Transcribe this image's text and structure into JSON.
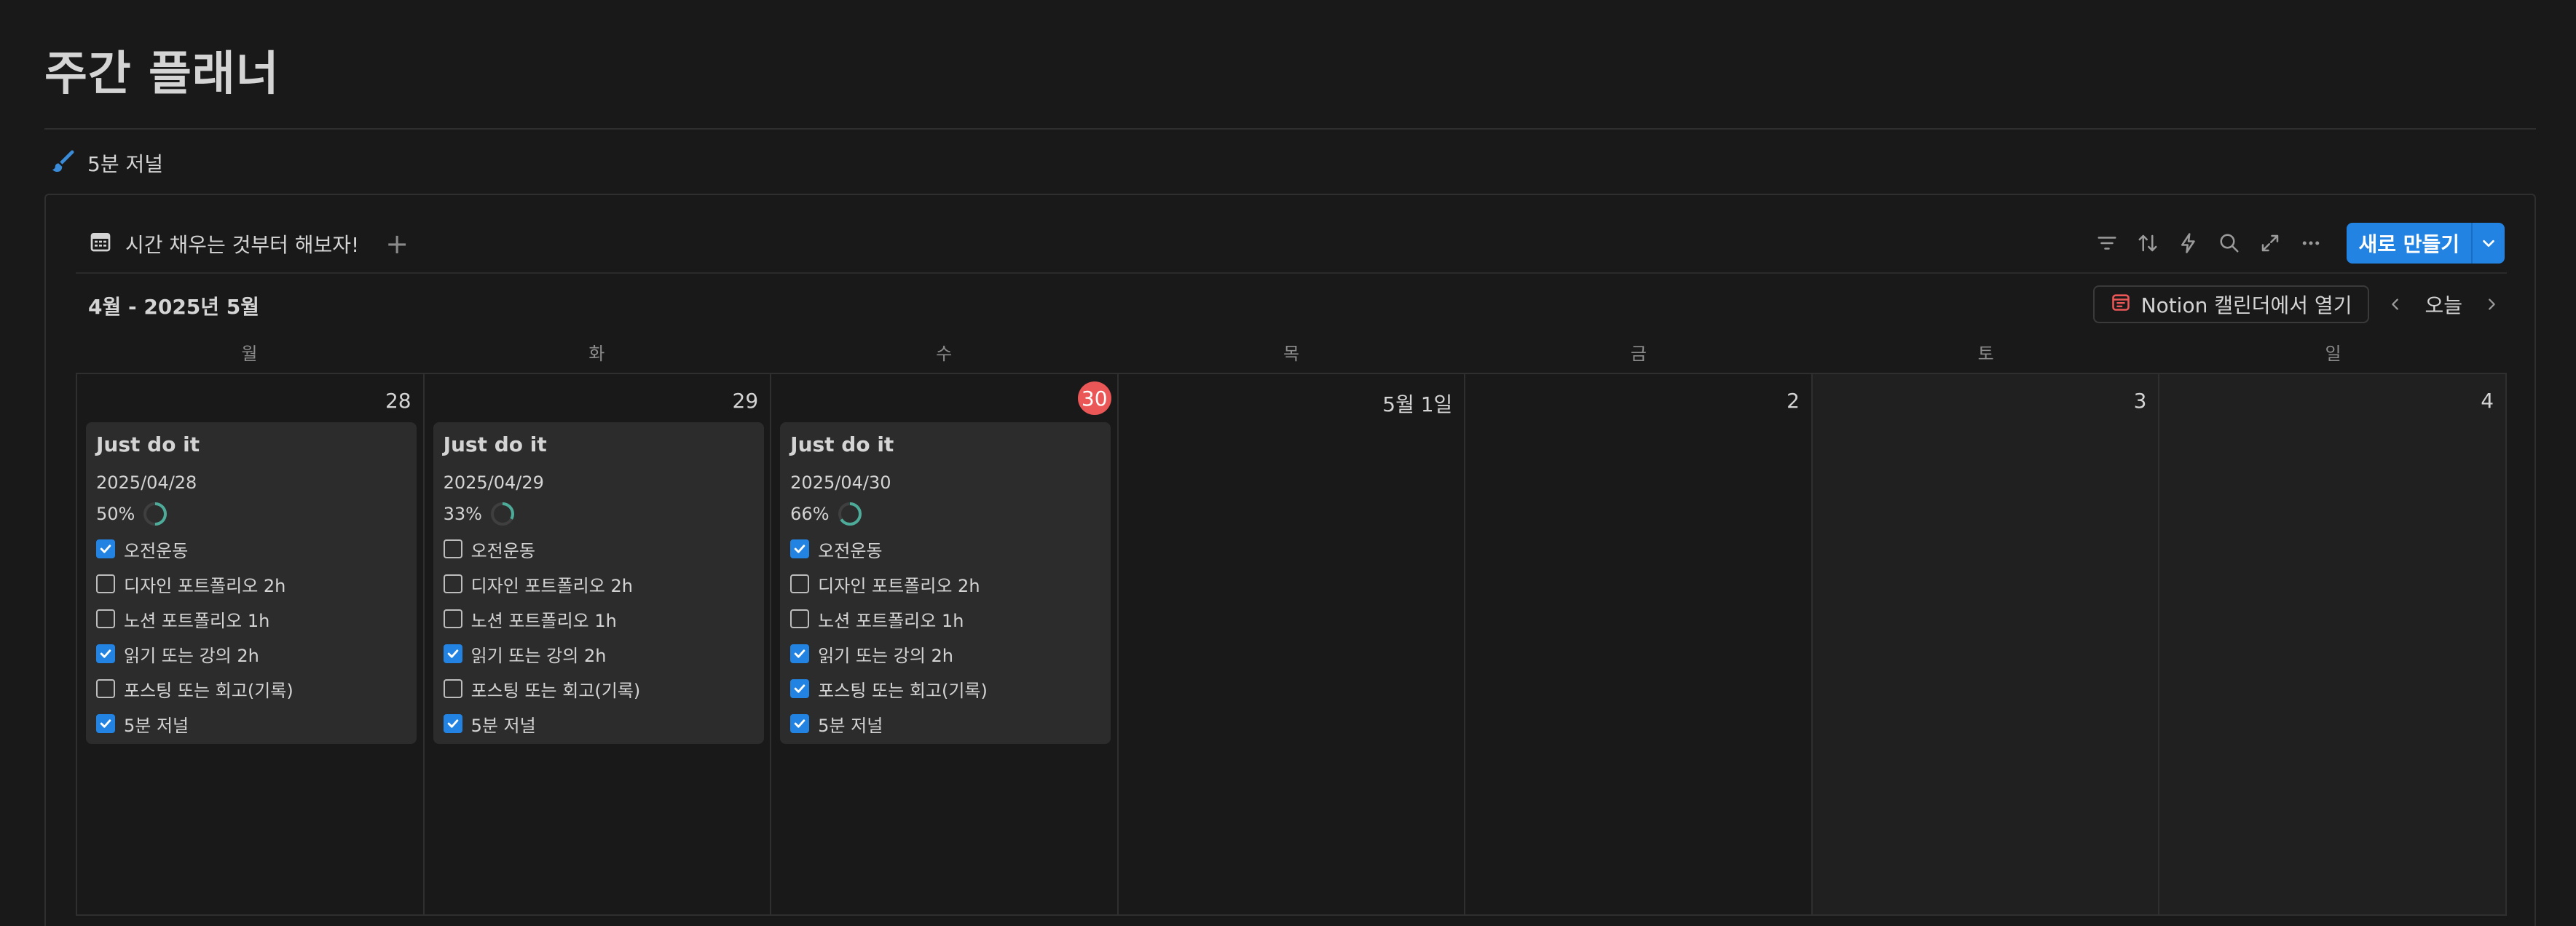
{
  "page": {
    "title": "주간 플래너"
  },
  "link": {
    "label": "5분 저널"
  },
  "view": {
    "tab_label": "시간 채우는 것부터 해보자!"
  },
  "toolbar": {
    "new_label": "새로 만들기"
  },
  "calendar": {
    "month_label": "4월 - 2025년 5월",
    "open_label": "Notion 캘린더에서 열기",
    "today_label": "오늘",
    "weekdays": [
      "월",
      "화",
      "수",
      "목",
      "금",
      "토",
      "일"
    ],
    "days": [
      {
        "num": "28",
        "today": false,
        "weekend": false
      },
      {
        "num": "29",
        "today": false,
        "weekend": false
      },
      {
        "num": "30",
        "today": true,
        "weekend": false
      },
      {
        "num": "5월 1일",
        "today": false,
        "weekend": false
      },
      {
        "num": "2",
        "today": false,
        "weekend": false
      },
      {
        "num": "3",
        "today": false,
        "weekend": true
      },
      {
        "num": "4",
        "today": false,
        "weekend": true
      }
    ]
  },
  "cards": [
    {
      "title": "Just do it",
      "date": "2025/04/28",
      "progress": 50,
      "progress_label": "50%",
      "tasks": [
        {
          "label": "오전운동",
          "checked": true
        },
        {
          "label": "디자인 포트폴리오 2h",
          "checked": false
        },
        {
          "label": "노션 포트폴리오 1h",
          "checked": false
        },
        {
          "label": "읽기 또는 강의 2h",
          "checked": true
        },
        {
          "label": "포스팅 또는 회고(기록)",
          "checked": false
        },
        {
          "label": "5분 저널",
          "checked": true
        }
      ]
    },
    {
      "title": "Just do it",
      "date": "2025/04/29",
      "progress": 33,
      "progress_label": "33%",
      "tasks": [
        {
          "label": "오전운동",
          "checked": false
        },
        {
          "label": "디자인 포트폴리오 2h",
          "checked": false
        },
        {
          "label": "노션 포트폴리오 1h",
          "checked": false
        },
        {
          "label": "읽기 또는 강의 2h",
          "checked": true
        },
        {
          "label": "포스팅 또는 회고(기록)",
          "checked": false
        },
        {
          "label": "5분 저널",
          "checked": true
        }
      ]
    },
    {
      "title": "Just do it",
      "date": "2025/04/30",
      "progress": 66,
      "progress_label": "66%",
      "tasks": [
        {
          "label": "오전운동",
          "checked": true
        },
        {
          "label": "디자인 포트폴리오 2h",
          "checked": false
        },
        {
          "label": "노션 포트폴리오 1h",
          "checked": false
        },
        {
          "label": "읽기 또는 강의 2h",
          "checked": true
        },
        {
          "label": "포스팅 또는 회고(기록)",
          "checked": true
        },
        {
          "label": "5분 저널",
          "checked": true
        }
      ]
    }
  ],
  "colors": {
    "accent": "#2383e2",
    "today": "#eb5757",
    "progress": "#4dab9a",
    "background": "#191919",
    "card": "#2c2c2c"
  },
  "icons": {
    "link": "paintbrush-icon",
    "view": "calendar-icon",
    "filter": "filter-icon",
    "sort": "sort-icon",
    "automation": "lightning-icon",
    "search": "search-icon",
    "expand": "expand-icon",
    "more": "more-icon",
    "open_calendar": "notion-calendar-icon",
    "prev": "chevron-left-icon",
    "next": "chevron-right-icon"
  }
}
